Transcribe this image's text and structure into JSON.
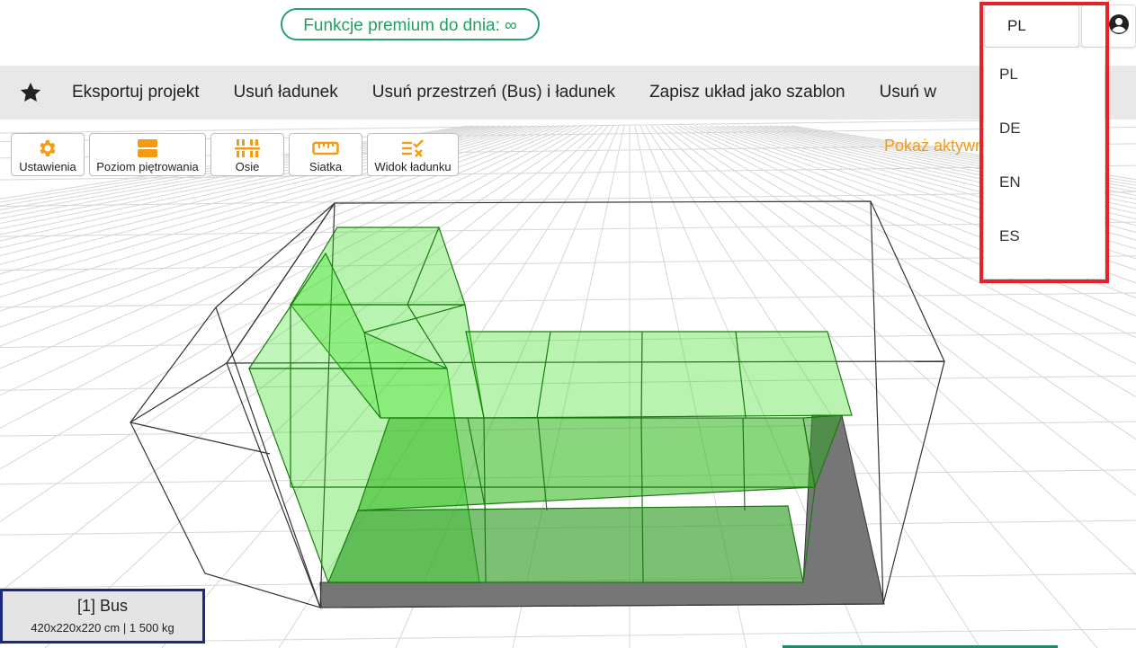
{
  "header": {
    "premium_label": "Funkcje premium do dnia: ∞"
  },
  "menu": {
    "items": [
      "Eksportuj projekt",
      "Usuń ładunek",
      "Usuń przestrzeń (Bus) i ładunek",
      "Zapisz układ jako szablon",
      "Usuń w"
    ]
  },
  "toolbar": {
    "settings": "Ustawienia",
    "stacking": "Poziom piętrowania",
    "axes": "Osie",
    "grid": "Siatka",
    "cargo_view": "Widok ładunku"
  },
  "show_active": "Pokaż aktywn",
  "language": {
    "selected": "PL",
    "options": [
      "PL",
      "DE",
      "EN",
      "ES"
    ]
  },
  "vehicle": {
    "title": "[1] Bus",
    "details": "420x220x220 cm | 1 500 kg"
  },
  "colors": {
    "accent_orange": "#f39c12",
    "premium_green": "#22a064",
    "highlight_red": "#e8202a",
    "cargo_green": "#33e01a"
  }
}
